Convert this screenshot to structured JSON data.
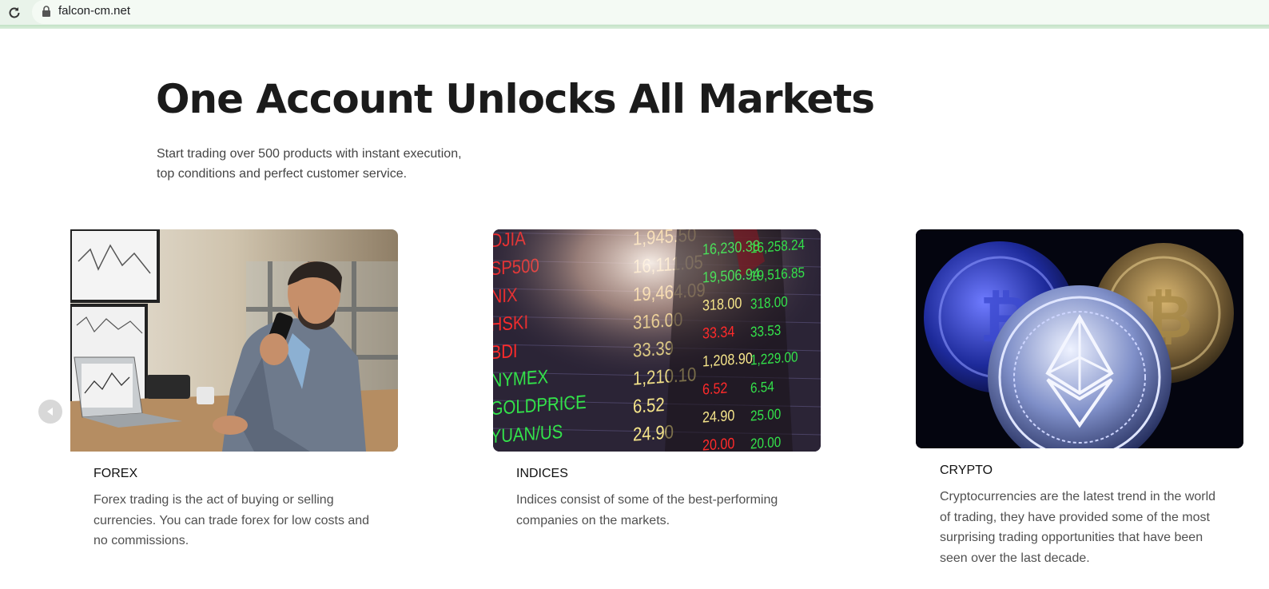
{
  "browser": {
    "url": "falcon-cm.net",
    "reload_icon": "reload-icon",
    "lock_icon": "lock-icon"
  },
  "hero": {
    "title": "One Account Unlocks All Markets",
    "subtitle_lines": [
      "Start trading over 500 products with instant execution,",
      "top conditions and perfect customer service."
    ]
  },
  "carousel": {
    "prev_icon": "chevron-left-icon",
    "cards": [
      {
        "title": "FOREX",
        "desc_lines": [
          "Forex trading is the act of buying or selling",
          "currencies. You can trade forex for low costs and",
          "no commissions."
        ]
      },
      {
        "title": "INDICES",
        "desc_lines": [
          "Indices consist of some of the best-performing",
          "companies on the markets."
        ]
      },
      {
        "title": "CRYPTO",
        "desc_lines": [
          "Cryptocurrencies are the latest trend in the world",
          "of trading, they have provided some of the most",
          "surprising trading opportunities that have been",
          "seen over the last decade."
        ]
      }
    ]
  },
  "ticker_board": {
    "symbols": [
      "DJIA",
      "SP500",
      "NIX",
      "HSKI",
      "BDI",
      "NYMEX",
      "GOLDPRICE",
      "YUAN/US"
    ],
    "prices": [
      "1,945.50",
      "16,111.05",
      "19,464.09",
      "316.00",
      "33.39",
      "1,210.10",
      "6.52",
      "24.90"
    ],
    "col2": [
      "16,230.38",
      "19,506.94",
      "318.00",
      "33.34",
      "1,208.90",
      "6.52",
      "24.90",
      "20.00"
    ],
    "col3": [
      "16,258.24",
      "19,516.85",
      "318.00",
      "33.53",
      "1,229.00",
      "6.54",
      "25.00",
      "20.00"
    ]
  },
  "colors": {
    "accent_bar": "#c3e2c6",
    "title": "#1b1b1b",
    "body_text": "#505050"
  }
}
